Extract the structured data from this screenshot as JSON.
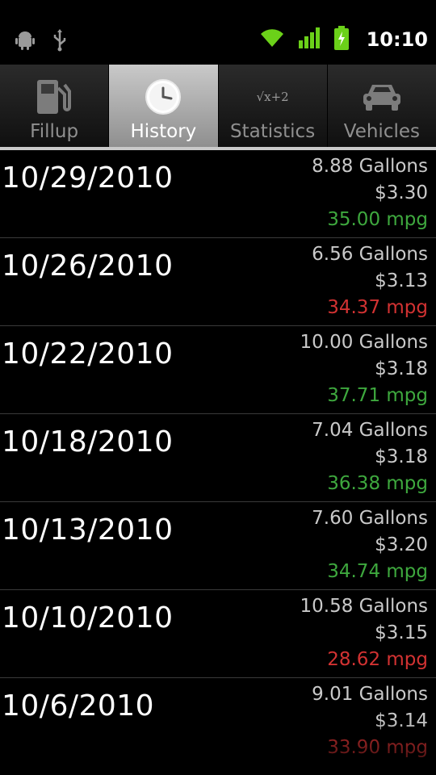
{
  "status_bar": {
    "time": "10:10",
    "icons": [
      "android-debug-icon",
      "usb-icon",
      "wifi-icon",
      "cell-signal-icon",
      "battery-charging-icon"
    ]
  },
  "tabs": [
    {
      "label": "Fillup",
      "icon": "fuel-pump-icon",
      "selected": false
    },
    {
      "label": "History",
      "icon": "clock-icon",
      "selected": true
    },
    {
      "label": "Statistics",
      "icon": "math-formula-icon",
      "selected": false
    },
    {
      "label": "Vehicles",
      "icon": "car-icon",
      "selected": false
    }
  ],
  "statistics_icon_text": "√x+2",
  "history": [
    {
      "date": "10/29/2010",
      "gallons": "8.88 Gallons",
      "price": "$3.30",
      "mpg": "35.00 mpg",
      "mpg_status": "good"
    },
    {
      "date": "10/26/2010",
      "gallons": "6.56 Gallons",
      "price": "$3.13",
      "mpg": "34.37 mpg",
      "mpg_status": "bad"
    },
    {
      "date": "10/22/2010",
      "gallons": "10.00 Gallons",
      "price": "$3.18",
      "mpg": "37.71 mpg",
      "mpg_status": "good"
    },
    {
      "date": "10/18/2010",
      "gallons": "7.04 Gallons",
      "price": "$3.18",
      "mpg": "36.38 mpg",
      "mpg_status": "good"
    },
    {
      "date": "10/13/2010",
      "gallons": "7.60 Gallons",
      "price": "$3.20",
      "mpg": "34.74 mpg",
      "mpg_status": "good"
    },
    {
      "date": "10/10/2010",
      "gallons": "10.58 Gallons",
      "price": "$3.15",
      "mpg": "28.62 mpg",
      "mpg_status": "bad"
    },
    {
      "date": "10/6/2010",
      "gallons": "9.01 Gallons",
      "price": "$3.14",
      "mpg": "33.90 mpg",
      "mpg_status": "bad"
    }
  ],
  "colors": {
    "mpg_good": "#3ea83e",
    "mpg_bad": "#d23232",
    "selected_tab": "#b5b5b5"
  }
}
